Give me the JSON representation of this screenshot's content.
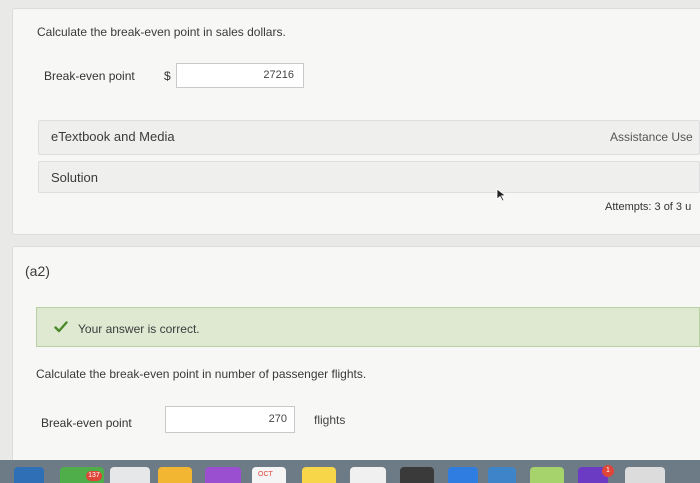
{
  "part_a1": {
    "instruction": "Calculate the break-even point in sales dollars.",
    "field_label": "Break-even point",
    "currency_symbol": "$",
    "answer_value": "27216"
  },
  "resources": {
    "etextbook_label": "eTextbook and Media",
    "solution_label": "Solution",
    "assistance_label": "Assistance Use",
    "attempts_label": "Attempts: 3 of 3 u"
  },
  "part_a2": {
    "section_label": "(a2)",
    "feedback": "Your answer is correct.",
    "instruction": "Calculate the break-even point in number of passenger flights.",
    "field_label": "Break-even point",
    "answer_value": "270",
    "unit": "flights"
  },
  "dock": {
    "badge_count": "137",
    "calendar_month": "OCT",
    "notification_count": "1"
  },
  "colors": {
    "correct_background": "#dfe9d2",
    "check_green": "#4a8a2a"
  }
}
